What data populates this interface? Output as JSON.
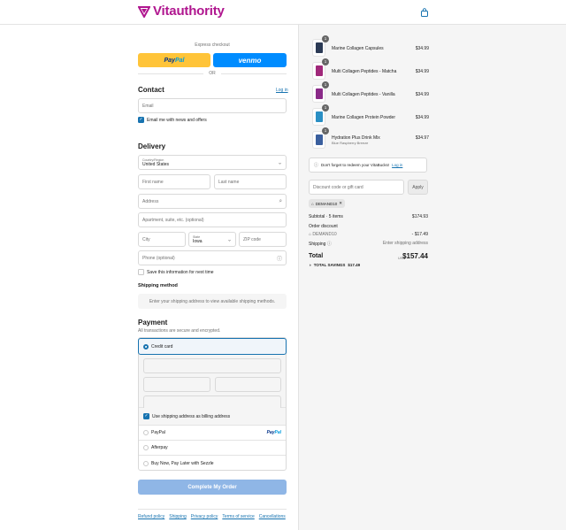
{
  "brand": {
    "name": "Vitauthority",
    "color": "#b0168f"
  },
  "express": {
    "title": "Express checkout",
    "paypal_a": "Pay",
    "paypal_b": "Pal",
    "venmo": "venmo",
    "or": "OR"
  },
  "contact": {
    "heading": "Contact",
    "login": "Log in",
    "email_placeholder": "Email",
    "news_label": "Email me with news and offers",
    "news_checked": true
  },
  "delivery": {
    "heading": "Delivery",
    "country_label": "Country/Region",
    "country_value": "United States",
    "first_name": "First name",
    "last_name": "Last name",
    "address": "Address",
    "apartment": "Apartment, suite, etc. (optional)",
    "city": "City",
    "state_label": "State",
    "state_value": "Iowa",
    "zip": "ZIP code",
    "phone": "Phone (optional)",
    "save_label": "Save this information for next time"
  },
  "shipping_method": {
    "heading": "Shipping method",
    "message": "Enter your shipping address to view available shipping methods."
  },
  "payment": {
    "heading": "Payment",
    "subtitle": "All transactions are secure and encrypted.",
    "credit_card": "Credit card",
    "billing_label": "Use shipping address as billing address",
    "options": [
      "PayPal",
      "Afterpay",
      "Buy Now, Pay Later with Sezzle"
    ],
    "paypal_logo_a": "Pay",
    "paypal_logo_b": "Pal"
  },
  "complete_button": "Complete My Order",
  "footer_links": [
    "Refund policy",
    "Shipping",
    "Privacy policy",
    "Terms of service",
    "Cancellations"
  ],
  "cart": {
    "items": [
      {
        "qty": "1",
        "name": "Marine Collagen Capsules",
        "sub": "",
        "price": "$34.99",
        "color": "#2b3a55"
      },
      {
        "qty": "1",
        "name": "Multi Collagen Peptides - Matcha",
        "sub": "",
        "price": "$34.99",
        "color": "#a0287a"
      },
      {
        "qty": "1",
        "name": "Multi Collagen Peptides - Vanilla",
        "sub": "",
        "price": "$34.99",
        "color": "#8a2a88"
      },
      {
        "qty": "1",
        "name": "Marine Collagen Protein Powder",
        "sub": "",
        "price": "$34.99",
        "color": "#2a8fc4"
      },
      {
        "qty": "1",
        "name": "Hydration Plus Drink Mix",
        "sub": "Blue Raspberry Breeze",
        "price": "$34.97",
        "color": "#3a5f9e"
      }
    ],
    "notice_text": "Don't forget to redeem your VitaBucks!",
    "notice_link": "Log in",
    "discount_placeholder": "Discount code or gift card",
    "apply": "Apply",
    "code_tag": "DEMAND10",
    "subtotal_label": "Subtotal · 5 items",
    "subtotal_value": "$174.93",
    "order_discount_label": "Order discount",
    "discount_code": "DEMAND10",
    "discount_value": "- $17.49",
    "shipping_label": "Shipping",
    "shipping_value": "Enter shipping address",
    "total_label": "Total",
    "currency": "USD",
    "total_value": "$157.44",
    "savings_label": "TOTAL SAVINGS",
    "savings_value": "$17.49"
  }
}
